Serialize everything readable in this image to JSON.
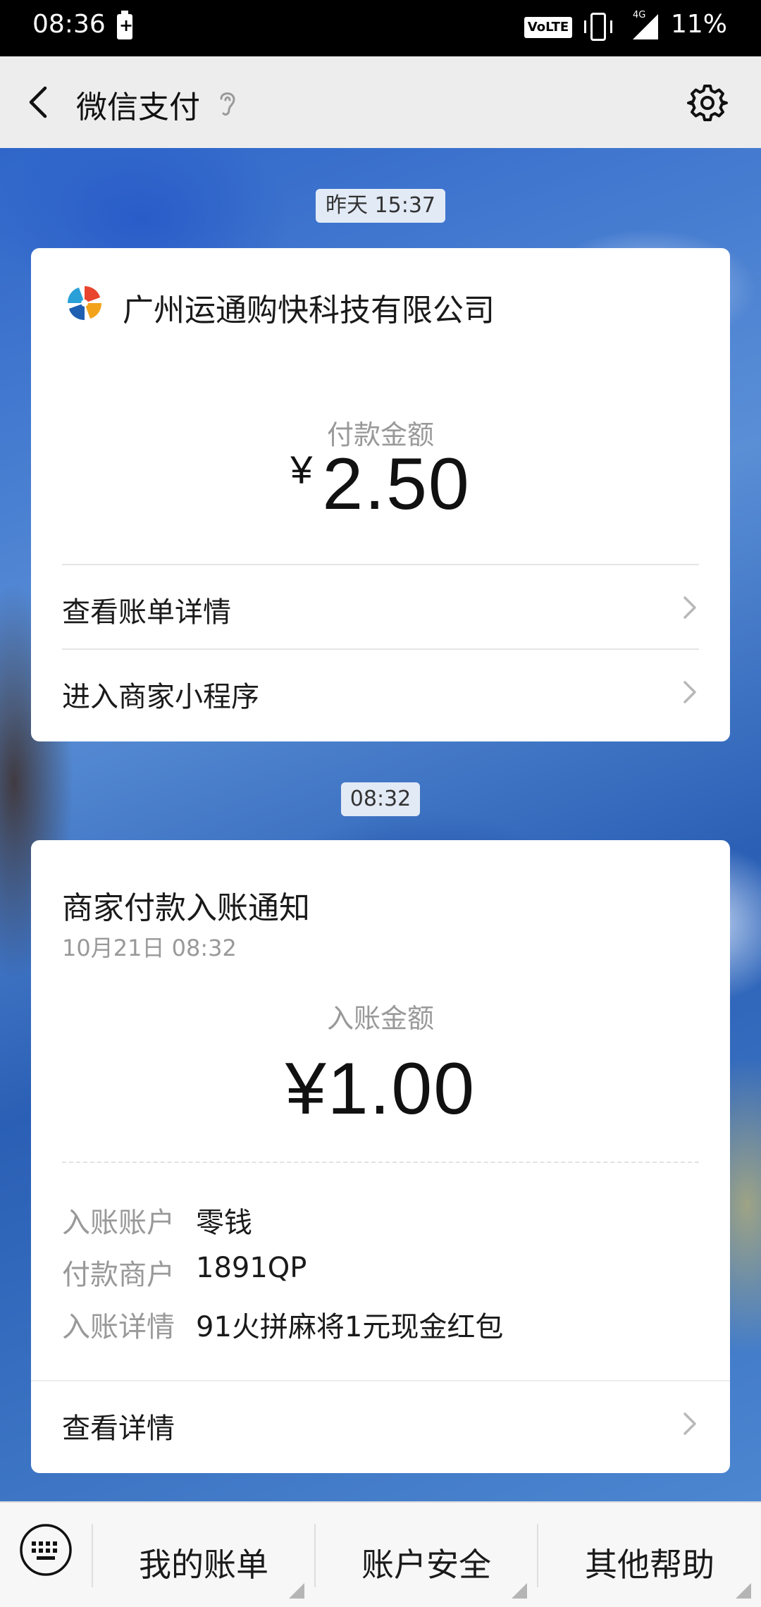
{
  "status_bar": {
    "time": "08:36",
    "volte": "VoLTE",
    "network": "4G",
    "battery": "11%"
  },
  "header": {
    "title": "微信支付",
    "icons": [
      "back-icon",
      "ear-icon",
      "gear-icon"
    ]
  },
  "messages": [
    {
      "time": "昨天 15:37",
      "merchant": "广州运通购快科技有限公司",
      "amount_label": "付款金额",
      "currency": "¥",
      "amount": "2.50",
      "links": [
        "查看账单详情",
        "进入商家小程序"
      ]
    },
    {
      "time": "08:32",
      "title": "商家付款入账通知",
      "date": "10月21日  08:32",
      "amount_label": "入账金额",
      "amount": "¥1.00",
      "details": [
        {
          "key": "入账账户",
          "value": "零钱"
        },
        {
          "key": "付款商户",
          "value": "1891QP"
        },
        {
          "key": "入账详情",
          "value": "91火拼麻将1元现金红包"
        }
      ],
      "link": "查看详情"
    }
  ],
  "bottom_menu": {
    "items": [
      "我的账单",
      "账户安全",
      "其他帮助"
    ]
  },
  "colors": {
    "status_bar": "#000000",
    "title_bar": "#ededed",
    "card": "#ffffff",
    "muted_text": "#999999"
  }
}
